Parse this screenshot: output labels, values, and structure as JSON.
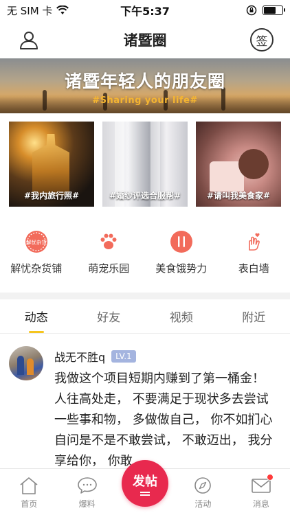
{
  "status_bar": {
    "carrier": "无 SIM 卡",
    "time": "下午5:37",
    "battery_level": 0.6
  },
  "nav": {
    "title": "诸暨圈",
    "sign_label": "签",
    "user_icon": "user-icon"
  },
  "banner": {
    "title": "诸暨年轻人的朋友圈",
    "subtitle": "#Sharing your life#"
  },
  "cards": [
    {
      "caption": "#我内旅行照#"
    },
    {
      "caption": "#婚纱评选合服帮#"
    },
    {
      "caption": "#请叫我美食家#"
    }
  ],
  "categories": [
    {
      "label": "解忧杂货铺",
      "icon": "grocery-badge-icon",
      "icon_text": "解忧杂货",
      "color": "#f26b5b"
    },
    {
      "label": "萌宠乐园",
      "icon": "paw-icon",
      "color": "#f26b5b"
    },
    {
      "label": "美食饿势力",
      "icon": "cutlery-icon",
      "color": "#f26b5b"
    },
    {
      "label": "表白墙",
      "icon": "heart-hand-icon",
      "color": "#f26b5b"
    }
  ],
  "tabs": [
    {
      "label": "动态",
      "active": true
    },
    {
      "label": "好友",
      "active": false
    },
    {
      "label": "视频",
      "active": false
    },
    {
      "label": "附近",
      "active": false
    }
  ],
  "post": {
    "author": "战无不胜q",
    "level": "LV.1",
    "content": "我做这个项目短期内赚到了第一桶金！ 人往高处走， 不要满足于现状多去尝试一些事和物， 多做做自己， 你不如扪心自问是不是不敢尝试， 不敢迈出， 我分享给你， 你敢"
  },
  "tabbar": {
    "items": [
      {
        "label": "首页",
        "icon": "home-icon"
      },
      {
        "label": "爆料",
        "icon": "chat-bubble-icon"
      },
      {
        "label": "活动",
        "icon": "compass-icon"
      },
      {
        "label": "消息",
        "icon": "mail-icon"
      }
    ],
    "post_button": "发帖"
  },
  "colors": {
    "accent": "#e8294e",
    "tab_indicator": "#f5c51f",
    "category_icon": "#f26b5b",
    "level_badge": "#a4b4df"
  }
}
